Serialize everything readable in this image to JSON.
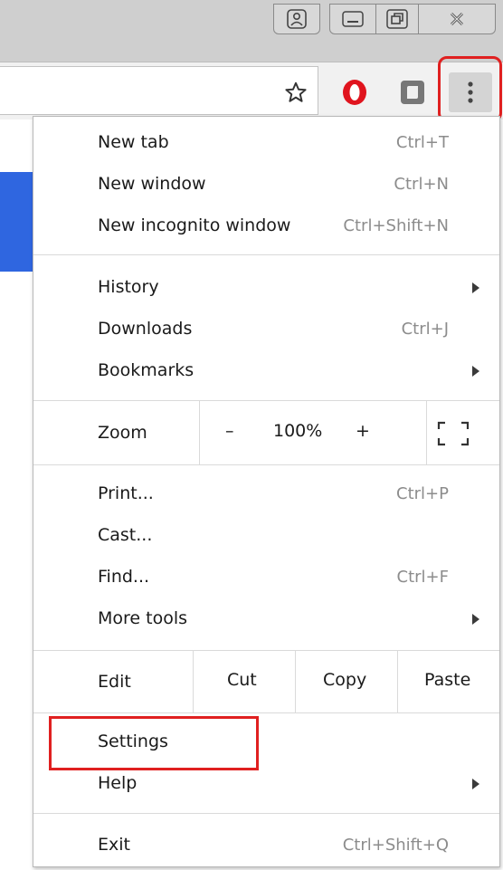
{
  "colors": {
    "highlight": "#e02020",
    "accent_blue": "#2f66e0"
  },
  "window_controls": {
    "profile_icon": "person-icon",
    "minimize_icon": "minimize-icon",
    "restore_icon": "restore-icon",
    "close_icon": "close-icon"
  },
  "toolbar": {
    "bookmark_icon": "star-icon",
    "extension_1_icon": "opera-o-icon",
    "extension_2_icon": "gray-square-icon",
    "menu_icon": "vertical-dots-icon"
  },
  "menu": {
    "section1": [
      {
        "label": "New tab",
        "shortcut": "Ctrl+T"
      },
      {
        "label": "New window",
        "shortcut": "Ctrl+N"
      },
      {
        "label": "New incognito window",
        "shortcut": "Ctrl+Shift+N"
      }
    ],
    "section2": [
      {
        "label": "History",
        "shortcut": ""
      },
      {
        "label": "Downloads",
        "shortcut": "Ctrl+J"
      },
      {
        "label": "Bookmarks",
        "shortcut": ""
      }
    ],
    "zoom": {
      "label": "Zoom",
      "minus": "–",
      "value": "100%",
      "plus": "+"
    },
    "section3": [
      {
        "label": "Print...",
        "shortcut": "Ctrl+P"
      },
      {
        "label": "Cast...",
        "shortcut": ""
      },
      {
        "label": "Find...",
        "shortcut": "Ctrl+F"
      },
      {
        "label": "More tools",
        "shortcut": ""
      }
    ],
    "edit": {
      "label": "Edit",
      "cut": "Cut",
      "copy": "Copy",
      "paste": "Paste"
    },
    "section4": [
      {
        "label": "Settings",
        "shortcut": ""
      },
      {
        "label": "Help",
        "shortcut": ""
      }
    ],
    "exit": {
      "label": "Exit",
      "shortcut": "Ctrl+Shift+Q"
    }
  }
}
